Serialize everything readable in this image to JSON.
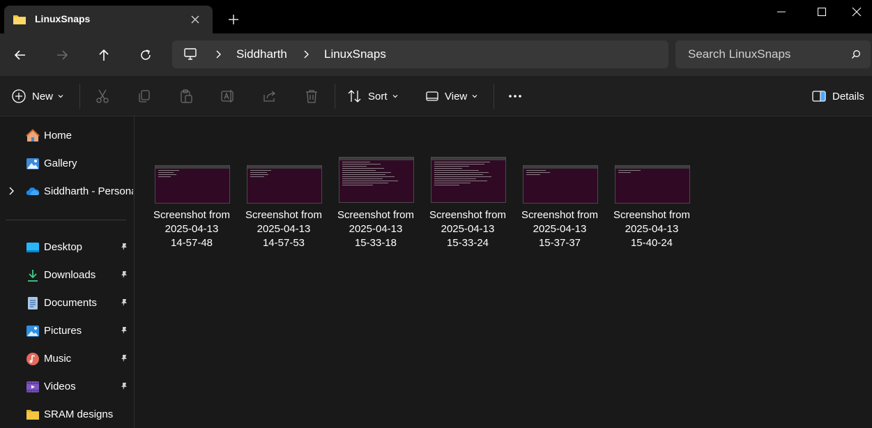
{
  "window": {
    "tab_title": "LinuxSnaps",
    "new_tab_label": "+"
  },
  "nav": {
    "breadcrumb": [
      "Siddharth",
      "LinuxSnaps"
    ],
    "search_placeholder": "Search LinuxSnaps"
  },
  "toolbar": {
    "new_label": "New",
    "sort_label": "Sort",
    "view_label": "View",
    "details_label": "Details"
  },
  "sidebar": {
    "top_items": [
      {
        "label": "Home",
        "icon": "home-icon"
      },
      {
        "label": "Gallery",
        "icon": "gallery-icon"
      },
      {
        "label": "Siddharth - Persona",
        "icon": "onedrive-icon"
      }
    ],
    "pinned_items": [
      {
        "label": "Desktop",
        "icon": "desktop-icon"
      },
      {
        "label": "Downloads",
        "icon": "downloads-icon"
      },
      {
        "label": "Documents",
        "icon": "documents-icon"
      },
      {
        "label": "Pictures",
        "icon": "pictures-icon"
      },
      {
        "label": "Music",
        "icon": "music-icon"
      },
      {
        "label": "Videos",
        "icon": "videos-icon"
      },
      {
        "label": "SRAM designs",
        "icon": "folder-icon"
      }
    ]
  },
  "files": [
    {
      "line1": "Screenshot from",
      "line2": "2025-04-13",
      "line3": "14-57-48"
    },
    {
      "line1": "Screenshot from",
      "line2": "2025-04-13",
      "line3": "14-57-53"
    },
    {
      "line1": "Screenshot from",
      "line2": "2025-04-13",
      "line3": "15-33-18"
    },
    {
      "line1": "Screenshot from",
      "line2": "2025-04-13",
      "line3": "15-33-24"
    },
    {
      "line1": "Screenshot from",
      "line2": "2025-04-13",
      "line3": "15-37-37"
    },
    {
      "line1": "Screenshot from",
      "line2": "2025-04-13",
      "line3": "15-40-24"
    }
  ],
  "colors": {
    "accent_folder": "#f5c542",
    "terminal_bg": "#300a24",
    "chrome_bg": "#2b2b2b"
  }
}
